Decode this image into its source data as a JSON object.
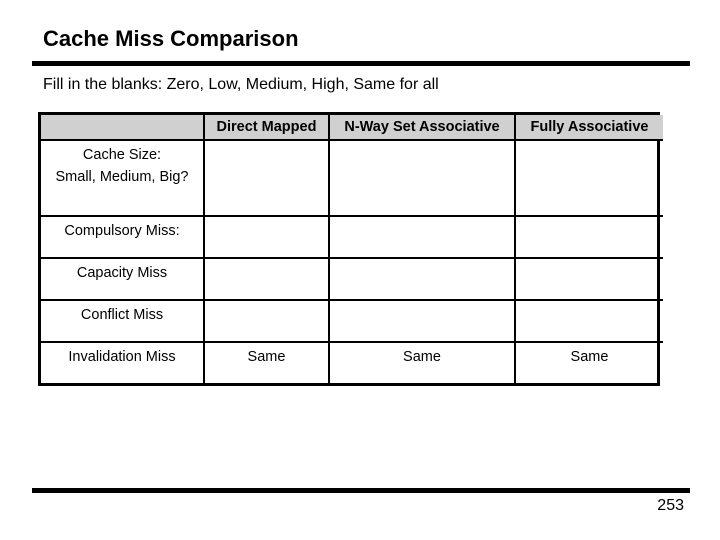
{
  "slide": {
    "title": "Cache Miss Comparison",
    "subtitle": "Fill in the blanks: Zero, Low, Medium, High, Same for all",
    "page_number": "253"
  },
  "table": {
    "columns": [
      "",
      "Direct Mapped",
      "N-Way Set Associative",
      "Fully Associative"
    ],
    "rows": [
      {
        "label": "Cache Size: Small, Medium, Big?",
        "label_line1": "Cache Size:",
        "label_line2": "Small, Medium, Big?",
        "values": [
          "",
          "",
          ""
        ]
      },
      {
        "label": "Compulsory Miss:",
        "values": [
          "",
          "",
          ""
        ]
      },
      {
        "label": "Capacity Miss",
        "values": [
          "",
          "",
          ""
        ]
      },
      {
        "label": "Conflict Miss",
        "values": [
          "",
          "",
          ""
        ]
      },
      {
        "label": "Invalidation Miss",
        "values": [
          "Same",
          "Same",
          "Same"
        ]
      }
    ]
  }
}
